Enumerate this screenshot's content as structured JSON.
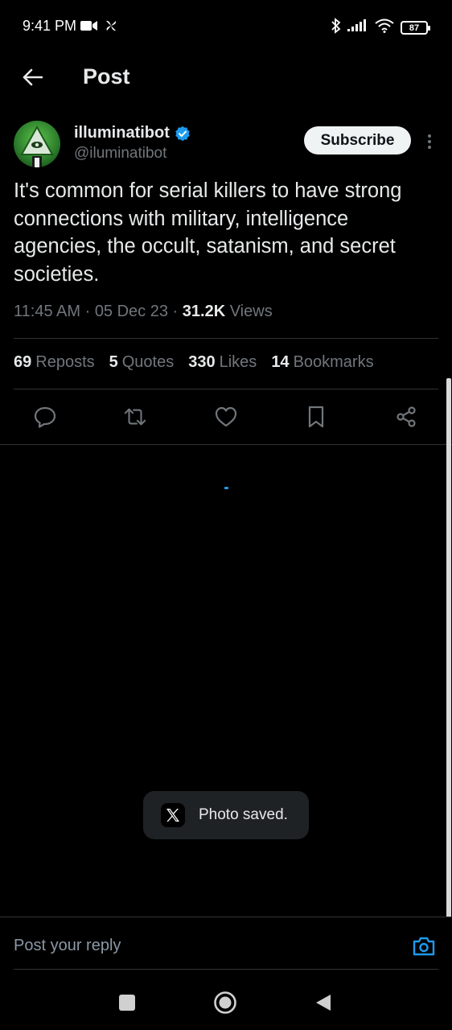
{
  "status_bar": {
    "time": "9:41 PM",
    "battery": "87",
    "icons": [
      "video-camera-icon",
      "pinwheel-icon",
      "bluetooth-icon",
      "signal-icon",
      "wifi-icon",
      "battery-icon"
    ]
  },
  "header": {
    "title": "Post",
    "back_icon": "arrow-left-icon"
  },
  "author": {
    "name": "illuminatibot",
    "handle": "@iluminatibot",
    "verified_icon": "verified-badge-icon",
    "subscribe_label": "Subscribe",
    "more_icon": "more-vertical-icon"
  },
  "tweet": {
    "text": "It's common for serial killers to have strong connections with military, intelligence agencies, the occult, satanism, and secret societies.",
    "time": "11:45 AM",
    "date": "05 Dec 23",
    "views_count": "31.2K",
    "views_label": "Views"
  },
  "stats": [
    {
      "num": "69",
      "label": "Reposts"
    },
    {
      "num": "5",
      "label": "Quotes"
    },
    {
      "num": "330",
      "label": "Likes"
    },
    {
      "num": "14",
      "label": "Bookmarks"
    }
  ],
  "actions": [
    "reply-icon",
    "repost-icon",
    "like-icon",
    "bookmark-icon",
    "share-icon"
  ],
  "toast": {
    "text": "Photo saved.",
    "logo": "x-logo-icon"
  },
  "reply": {
    "placeholder": "Post your reply",
    "camera_icon": "camera-icon"
  },
  "colors": {
    "background": "#000000",
    "primary_text": "#e7e9ea",
    "secondary_text": "#71767b",
    "accent": "#1d9bf0",
    "divider": "#2f3336"
  }
}
